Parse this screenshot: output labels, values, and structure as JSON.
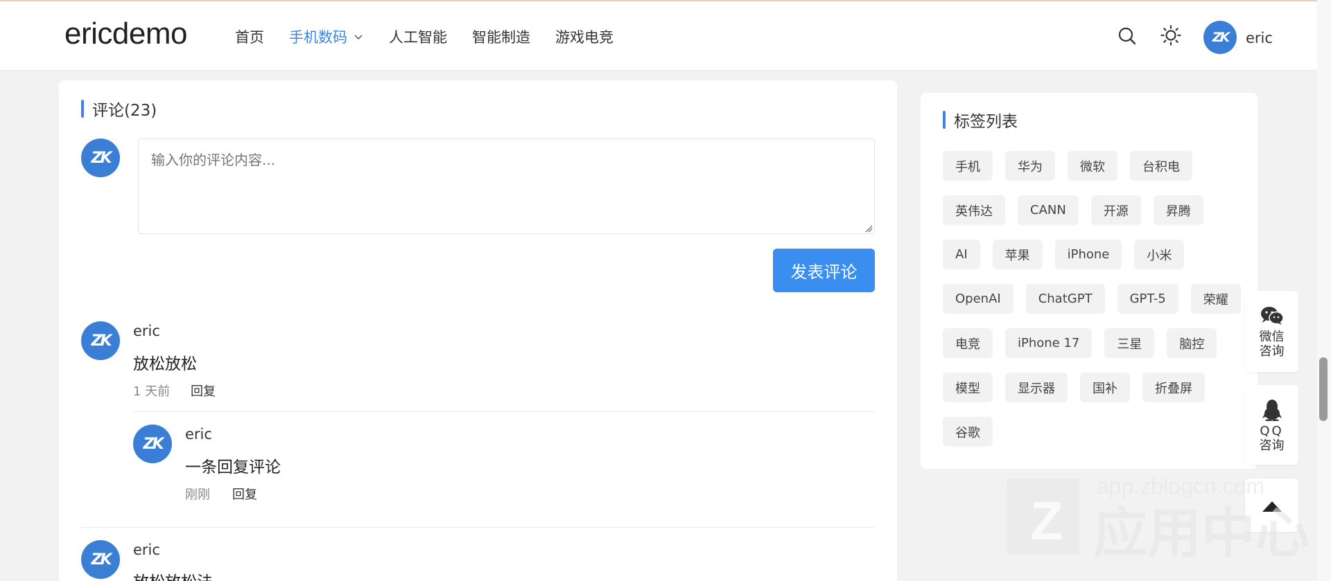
{
  "header": {
    "logo": "ericdemo",
    "nav": [
      {
        "label": "首页",
        "active": false
      },
      {
        "label": "手机数码",
        "active": true,
        "has_dropdown": true
      },
      {
        "label": "人工智能",
        "active": false
      },
      {
        "label": "智能制造",
        "active": false
      },
      {
        "label": "游戏电竞",
        "active": false
      }
    ],
    "icons": [
      "search-icon",
      "sun-icon"
    ],
    "user": {
      "name": "eric",
      "avatar_glyph": "ZK"
    }
  },
  "comments_section": {
    "title": "评论(23)",
    "input_placeholder": "输入你的评论内容...",
    "submit_label": "发表评论",
    "comments": [
      {
        "author": "eric",
        "text": "放松放松",
        "time": "1 天前",
        "reply_label": "回复",
        "replies": [
          {
            "author": "eric",
            "text": "一条回复评论",
            "time": "刚刚",
            "reply_label": "回复"
          }
        ]
      },
      {
        "author": "eric",
        "text": "放松放松法"
      }
    ]
  },
  "sidebar": {
    "title": "标签列表",
    "tags": [
      "手机",
      "华为",
      "微软",
      "台积电",
      "英伟达",
      "CANN",
      "开源",
      "昇腾",
      "AI",
      "苹果",
      "iPhone",
      "小米",
      "OpenAI",
      "ChatGPT",
      "GPT-5",
      "荣耀",
      "电竞",
      "iPhone 17",
      "三星",
      "脑控",
      "模型",
      "显示器",
      "国补",
      "折叠屏",
      "谷歌"
    ]
  },
  "float_buttons": {
    "wechat": {
      "line1": "微信",
      "line2": "咨询"
    },
    "qq": {
      "line1": "QQ",
      "line2": "咨询"
    }
  },
  "watermark": {
    "url": "app.zblogcn.com",
    "text": "应用中心"
  },
  "colors": {
    "accent": "#3a86e8",
    "avatar": "#3a7fd5",
    "button": "#3a8ef0"
  }
}
